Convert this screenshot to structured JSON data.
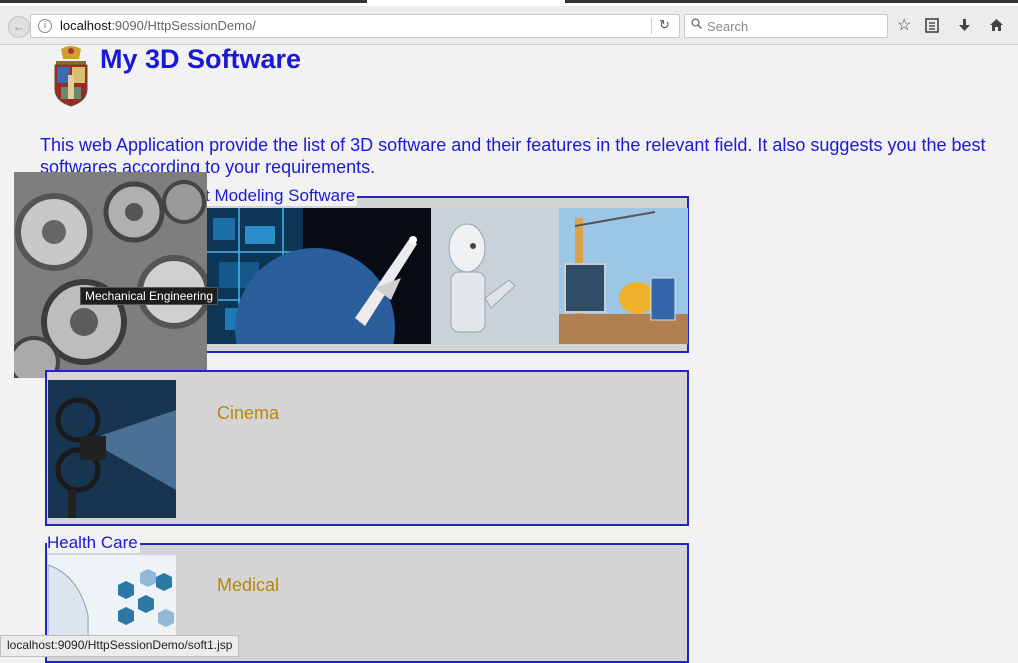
{
  "browser": {
    "url_host": "localhost",
    "url_rest": ":9090/HttpSessionDemo/",
    "search_placeholder": "Search",
    "status_url": "localhost:9090/HttpSessionDemo/soft1.jsp"
  },
  "page": {
    "title": "My 3D Software",
    "intro": "This web Application provide the list of 3D software and their features in the relevant field. It also suggests you the best softwares according to your requirements."
  },
  "sections": [
    {
      "legend": "t Modeling Software",
      "images": [
        "Mechanical Engineering",
        "circuit board",
        "space shuttle",
        "robot",
        "construction site"
      ],
      "tooltip": "Mechanical Engineering"
    },
    {
      "legend": "",
      "label": "Cinema",
      "image": "film projector"
    },
    {
      "legend": "Health Care",
      "label": "Medical",
      "image": "medical technology"
    }
  ],
  "icons": [
    "back-arrow-icon",
    "info-icon",
    "reload-icon",
    "search-icon",
    "bookmark-star-icon",
    "reading-list-icon",
    "download-icon",
    "home-icon"
  ]
}
